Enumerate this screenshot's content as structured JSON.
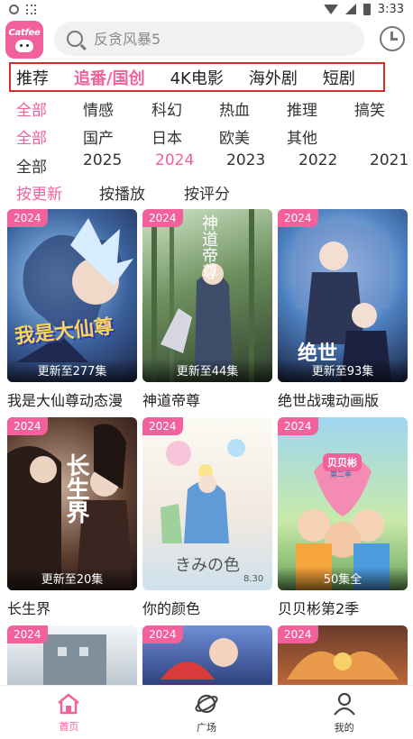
{
  "status_bar": {
    "time": "3:33"
  },
  "header": {
    "logo_text": "Catfee",
    "search_placeholder": "反贪风暴5"
  },
  "category_tabs": [
    {
      "label": "推荐",
      "active": false
    },
    {
      "label": "追番/国创",
      "active": true
    },
    {
      "label": "4K电影",
      "active": false
    },
    {
      "label": "海外剧",
      "active": false
    },
    {
      "label": "短剧",
      "active": false
    }
  ],
  "filters": {
    "genre": [
      "全部",
      "情感",
      "科幻",
      "热血",
      "推理",
      "搞笑"
    ],
    "region": [
      "全部",
      "国产",
      "日本",
      "欧美",
      "其他"
    ],
    "year": [
      "全部",
      "2025",
      "2024",
      "2023",
      "2022",
      "2021"
    ],
    "sort": [
      "按更新",
      "按播放",
      "按评分"
    ]
  },
  "selected": {
    "genre": "全部",
    "region": "全部",
    "year": "2024",
    "sort": "按更新"
  },
  "cards": [
    {
      "title": "我是大仙尊动态漫",
      "year": "2024",
      "episode": "更新至277集"
    },
    {
      "title": "神道帝尊",
      "year": "2024",
      "episode": "更新至44集"
    },
    {
      "title": "绝世战魂动画版",
      "year": "2024",
      "episode": "更新至93集"
    },
    {
      "title": "长生界",
      "year": "2024",
      "episode": "更新至20集"
    },
    {
      "title": "你的颜色",
      "year": "2024",
      "episode": ""
    },
    {
      "title": "贝贝彬第2季",
      "year": "2024",
      "episode": "50集全"
    },
    {
      "title": "",
      "year": "2024",
      "episode": ""
    },
    {
      "title": "",
      "year": "2024",
      "episode": ""
    },
    {
      "title": "",
      "year": "2024",
      "episode": ""
    }
  ],
  "poster_text": {
    "card1": "我是大仙尊",
    "card2": "神道帝尊",
    "card3": "绝世",
    "card4": "长生界",
    "card5_title": "きみの色",
    "card5_date": "8.30",
    "card6_logo": "贝贝彬",
    "card6_sub": "第二季"
  },
  "bottom_nav": [
    {
      "label": "首页",
      "icon": "home-icon",
      "active": true
    },
    {
      "label": "广场",
      "icon": "planet-icon",
      "active": false
    },
    {
      "label": "我的",
      "icon": "user-icon",
      "active": false
    }
  ],
  "colors": {
    "accent": "#f2619b",
    "highlight_border": "#d92b2b"
  }
}
